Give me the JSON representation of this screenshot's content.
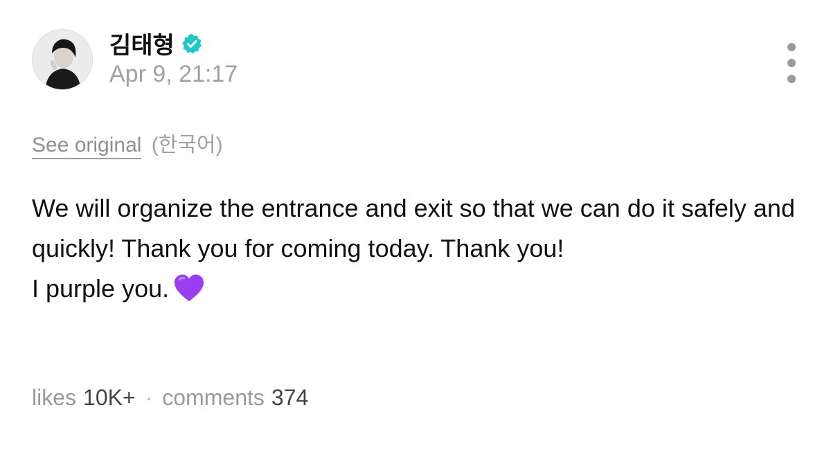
{
  "post": {
    "author": {
      "name": "김태형",
      "verified": true
    },
    "timestamp": "Apr 9, 21:17",
    "translation": {
      "see_original": "See original",
      "language": "(한국어)"
    },
    "content": {
      "line1": "We will organize the entrance and exit so that we can do it safely and quickly! Thank you for coming today. Thank you!",
      "line2": "I purple you.",
      "emoji": "purple-heart"
    },
    "stats": {
      "likes_label": "likes",
      "likes_value": "10K+",
      "separator": "·",
      "comments_label": "comments",
      "comments_value": "374"
    }
  },
  "colors": {
    "verified_badge": "#1ec8c8",
    "heart": "#9b3df0",
    "muted_text": "#a0a0a0"
  },
  "icons": {
    "more": "vertical-ellipsis-icon",
    "verified": "verified-badge-icon",
    "heart": "purple-heart-icon"
  }
}
